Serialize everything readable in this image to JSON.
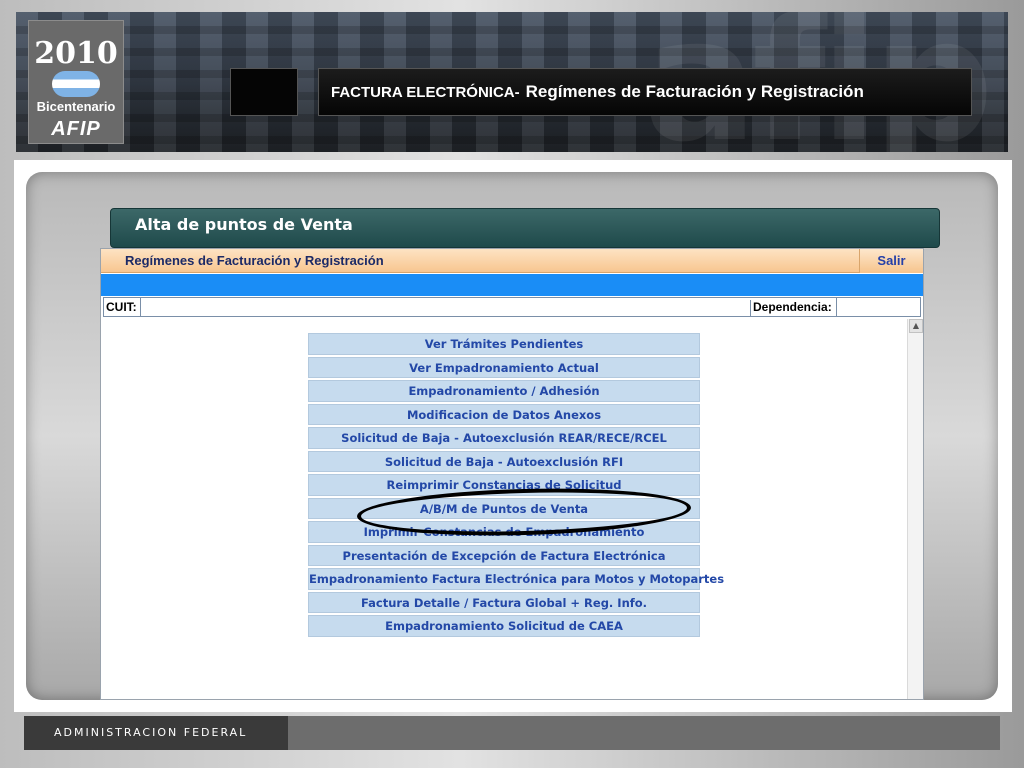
{
  "header": {
    "logo": {
      "year": "2010",
      "subtitle": "Bicentenario",
      "brand": "AFIP"
    },
    "title_prefix": "FACTURA ELECTRÓNICA-",
    "title_main": "Regímenes de Facturación y Registración"
  },
  "banner": {
    "title": "Alta de puntos de Venta"
  },
  "form": {
    "title": "Regímenes de Facturación y Registración",
    "exit_label": "Salir",
    "cuit_label": "CUIT:",
    "cuit_value": "",
    "dependencia_label": "Dependencia:",
    "dependencia_value": ""
  },
  "menu": {
    "items": [
      "Ver Trámites Pendientes",
      "Ver Empadronamiento Actual",
      "Empadronamiento / Adhesión",
      "Modificacion de Datos Anexos",
      "Solicitud de Baja - Autoexclusión REAR/RECE/RCEL",
      "Solicitud de Baja - Autoexclusión RFI",
      "Reimprimir Constancias de Solicitud",
      "A/B/M de Puntos de Venta",
      "Imprimir Constancias de Empadronamiento",
      "Presentación de Excepción de Factura Electrónica",
      "Empadronamiento Factura Electrónica para Motos y Motopartes",
      "Factura Detalle / Factura Global + Reg. Info.",
      "Empadronamiento Solicitud de CAEA"
    ],
    "highlighted_item": "A/B/M de Puntos de Venta"
  },
  "footer": {
    "label": "ADMINISTRACION FEDERAL"
  },
  "colors": {
    "banner": "#2b5656",
    "form_header": "#f8c690",
    "blue_bar": "#1a8df6",
    "menu_item_bg": "#c6dbee",
    "menu_item_text": "#2348a7",
    "annotation": "#000000"
  }
}
